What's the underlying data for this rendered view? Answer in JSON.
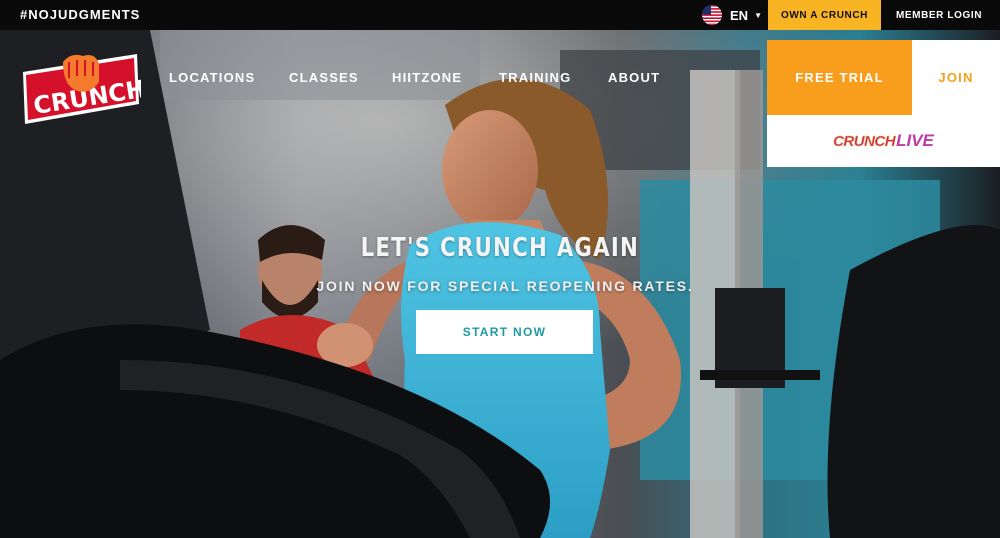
{
  "topbar": {
    "hashtag": "#NOJUDGMENTS",
    "language": "EN",
    "flag_icon": "us-flag-icon",
    "own_label": "OWN A CRUNCH",
    "login_label": "MEMBER LOGIN",
    "own_bg": "#f9b424"
  },
  "brand": {
    "logo_text": "CRUNCH",
    "logo_colors": {
      "red": "#d4102a",
      "orange": "#f47b2b"
    }
  },
  "nav": {
    "items": [
      {
        "label": "LOCATIONS"
      },
      {
        "label": "CLASSES"
      },
      {
        "label": "HIITZONE"
      },
      {
        "label": "TRAINING"
      },
      {
        "label": "ABOUT"
      }
    ]
  },
  "cta": {
    "free_trial": "FREE TRIAL",
    "join": "JOIN",
    "free_trial_bg": "#f99d1c",
    "join_color": "#f6a01a",
    "live_crunch": "CRUNCH",
    "live_live": "LIVE"
  },
  "hero": {
    "headline": "LET'S CRUNCH AGAIN",
    "subhead": "JOIN NOW FOR SPECIAL REOPENING RATES.",
    "button": "START NOW",
    "button_color": "#1d9aa3"
  }
}
